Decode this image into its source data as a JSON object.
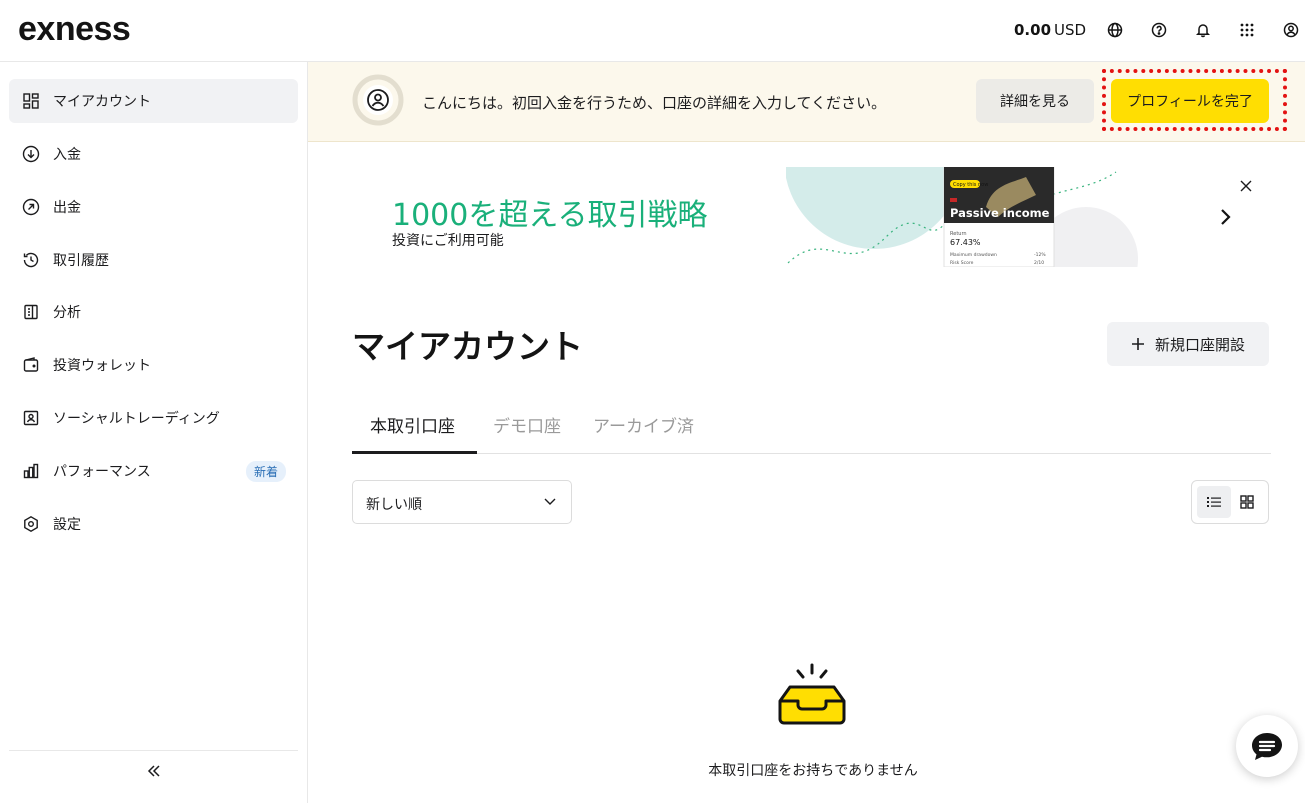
{
  "header": {
    "logo": "exness",
    "balance_amount": "0.00",
    "balance_currency": "USD",
    "icons": [
      "globe-icon",
      "help-icon",
      "bell-icon",
      "apps-grid-icon",
      "user-icon"
    ]
  },
  "sidebar": {
    "items": [
      {
        "label": "マイアカウント",
        "icon": "dashboard-icon",
        "active": true
      },
      {
        "label": "入金",
        "icon": "deposit-icon"
      },
      {
        "label": "出金",
        "icon": "withdraw-icon"
      },
      {
        "label": "取引履歴",
        "icon": "history-icon"
      },
      {
        "label": "分析",
        "icon": "analytics-icon"
      },
      {
        "label": "投資ウォレット",
        "icon": "wallet-icon"
      },
      {
        "label": "ソーシャルトレーディング",
        "icon": "social-trading-icon"
      },
      {
        "label": "パフォーマンス",
        "icon": "performance-icon",
        "badge": "新着"
      },
      {
        "label": "設定",
        "icon": "settings-icon"
      }
    ],
    "collapse_icon": "double-chevron-left-icon"
  },
  "notice": {
    "text": "こんにちは。初回入金を行うため、口座の詳細を入力してください。",
    "detail_button": "詳細を見る",
    "profile_button": "プロフィールを完了"
  },
  "promo": {
    "title": "1000を超える取引戦略",
    "subtitle": "投資にご利用可能",
    "card": {
      "tag": "Copy this now",
      "name": "Passive income",
      "return_label": "Return",
      "return_value": "67.43%",
      "drawdown_label": "Maximum drawdown",
      "drawdown_value": "-12%",
      "risk_label": "Risk Score",
      "risk_value": "2/10"
    }
  },
  "main": {
    "title": "マイアカウント",
    "new_account_button": "新規口座開設",
    "tabs": [
      {
        "label": "本取引口座",
        "active": true
      },
      {
        "label": "デモ口座"
      },
      {
        "label": "アーカイブ済"
      }
    ],
    "sort": {
      "selected": "新しい順"
    },
    "empty_text": "本取引口座をお持ちでありません"
  },
  "colors": {
    "brand_yellow": "#ffde02",
    "promo_green": "#1ab07a",
    "highlight_red": "#e31313",
    "notice_bg": "#fcf8ec"
  }
}
